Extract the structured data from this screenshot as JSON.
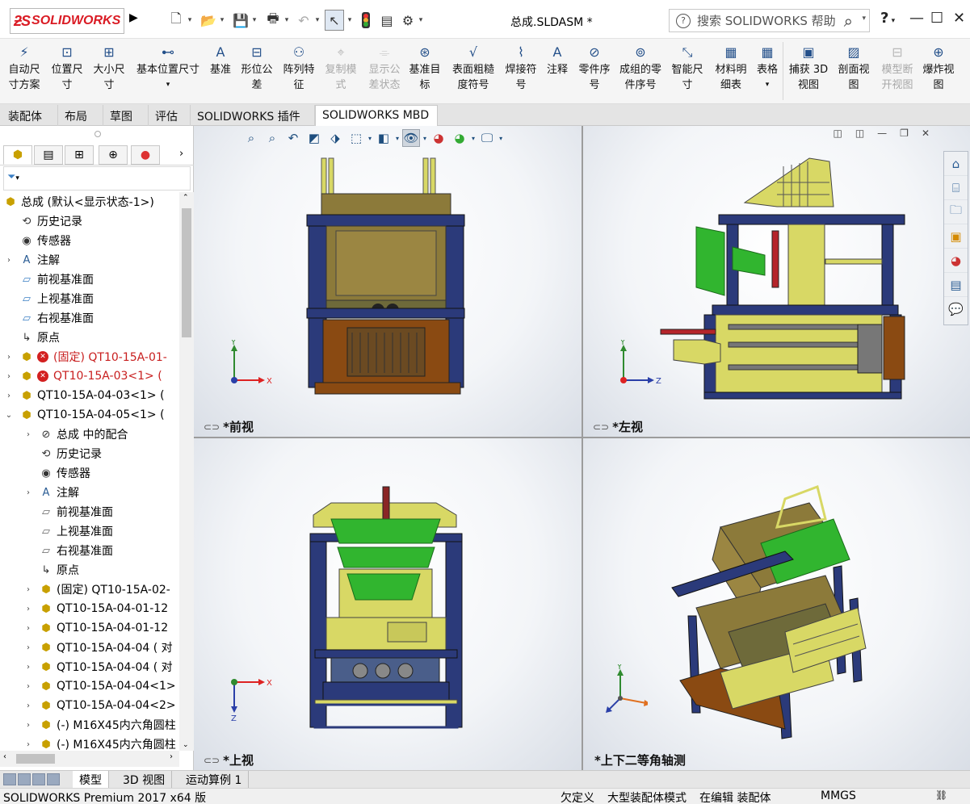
{
  "app": {
    "logo": "SOLIDWORKS",
    "doc_title": "总成.SLDASM *",
    "help_placeholder": "搜索 SOLIDWORKS 帮助",
    "help": "?",
    "colors": {
      "logo_red": "#da1b24",
      "steel_blue": "#2b3a7a",
      "yellow_green": "#d8d865",
      "green": "#31b52f",
      "brown": "#8a4a12"
    }
  },
  "commands": [
    {
      "label": "自动尺\n寸方案",
      "icon": "auto-dimension-icon"
    },
    {
      "label": "位置尺\n寸",
      "icon": "location-dimension-icon"
    },
    {
      "label": "大小尺\n寸",
      "icon": "size-dimension-icon"
    },
    {
      "label": "基本位置尺寸",
      "icon": "basic-location-dimension-icon"
    },
    {
      "label": "基准",
      "icon": "datum-icon"
    },
    {
      "label": "形位公\n差",
      "icon": "geometric-tolerance-icon"
    },
    {
      "label": "阵列特\n征",
      "icon": "pattern-feature-icon"
    },
    {
      "label": "复制模\n式",
      "icon": "copy-scheme-icon",
      "disabled": true
    },
    {
      "label": "显示公\n差状态",
      "icon": "show-tolerance-status-icon",
      "disabled": true
    },
    {
      "label": "基准目\n标",
      "icon": "datum-target-icon"
    },
    {
      "label": "表面粗糙\n度符号",
      "icon": "surface-finish-icon"
    },
    {
      "label": "焊接符\n号",
      "icon": "weld-symbol-icon"
    },
    {
      "label": "注释",
      "icon": "note-icon"
    },
    {
      "label": "零件序\n号",
      "icon": "balloon-icon"
    },
    {
      "label": "成组的零\n件序号",
      "icon": "stacked-balloon-icon"
    },
    {
      "label": "智能尺\n寸",
      "icon": "smart-dimension-icon"
    },
    {
      "label": "材料明\n细表",
      "icon": "bom-icon"
    },
    {
      "label": "表格",
      "icon": "table-icon"
    },
    {
      "label": "捕获 3D\n视图",
      "icon": "capture-3d-view-icon"
    },
    {
      "label": "剖面视\n图",
      "icon": "section-view-icon"
    },
    {
      "label": "模型断\n开视图",
      "icon": "model-break-view-icon",
      "disabled": true
    },
    {
      "label": "爆炸视\n图",
      "icon": "exploded-view-icon"
    }
  ],
  "tabs": [
    "装配体",
    "布局",
    "草图",
    "评估",
    "SOLIDWORKS 插件",
    "SOLIDWORKS MBD"
  ],
  "tree": [
    {
      "text": "总成  (默认<显示状态-1>)",
      "level": 0,
      "icon": "assembly",
      "exp": ""
    },
    {
      "text": "历史记录",
      "level": 1,
      "icon": "history"
    },
    {
      "text": "传感器",
      "level": 1,
      "icon": "sensor"
    },
    {
      "text": "注解",
      "level": 1,
      "icon": "annotation",
      "exp": "›"
    },
    {
      "text": "前视基准面",
      "level": 1,
      "icon": "plane"
    },
    {
      "text": "上视基准面",
      "level": 1,
      "icon": "plane"
    },
    {
      "text": "右视基准面",
      "level": 1,
      "icon": "plane"
    },
    {
      "text": "原点",
      "level": 1,
      "icon": "origin"
    },
    {
      "text": "(固定) QT10-15A-01-",
      "level": 1,
      "icon": "part",
      "exp": "›",
      "error": true
    },
    {
      "text": "QT10-15A-03<1> (",
      "level": 1,
      "icon": "part",
      "exp": "›",
      "error": true
    },
    {
      "text": "QT10-15A-04-03<1> (",
      "level": 1,
      "icon": "part",
      "exp": "›"
    },
    {
      "text": "QT10-15A-04-05<1> (",
      "level": 1,
      "icon": "part",
      "exp": "⌄"
    },
    {
      "text": "总成 中的配合",
      "level": 2,
      "icon": "mates",
      "exp": "›"
    },
    {
      "text": "历史记录",
      "level": 2,
      "icon": "history"
    },
    {
      "text": "传感器",
      "level": 2,
      "icon": "sensor"
    },
    {
      "text": "注解",
      "level": 2,
      "icon": "annotation",
      "exp": "›"
    },
    {
      "text": "前视基准面",
      "level": 2,
      "icon": "plane-outline"
    },
    {
      "text": "上视基准面",
      "level": 2,
      "icon": "plane-outline"
    },
    {
      "text": "右视基准面",
      "level": 2,
      "icon": "plane-outline"
    },
    {
      "text": "原点",
      "level": 2,
      "icon": "origin"
    },
    {
      "text": "(固定) QT10-15A-02-",
      "level": 2,
      "icon": "subasm",
      "exp": "›"
    },
    {
      "text": "QT10-15A-04-01-12",
      "level": 2,
      "icon": "subasm",
      "exp": "›"
    },
    {
      "text": "QT10-15A-04-01-12",
      "level": 2,
      "icon": "subasm",
      "exp": "›"
    },
    {
      "text": "QT10-15A-04-04 ( 对",
      "level": 2,
      "icon": "part",
      "exp": "›"
    },
    {
      "text": "QT10-15A-04-04 ( 对",
      "level": 2,
      "icon": "part",
      "exp": "›"
    },
    {
      "text": "QT10-15A-04-04<1>",
      "level": 2,
      "icon": "part",
      "exp": "›"
    },
    {
      "text": "QT10-15A-04-04<2>",
      "level": 2,
      "icon": "part",
      "exp": "›"
    },
    {
      "text": "(-) M16X45内六角圆柱",
      "level": 2,
      "icon": "part",
      "exp": "›"
    },
    {
      "text": "(-) M16X45内六角圆柱",
      "level": 2,
      "icon": "part",
      "exp": "›"
    }
  ],
  "viewports": [
    {
      "label": "*前视",
      "axes": [
        "X",
        "Y"
      ]
    },
    {
      "label": "*左视",
      "axes": [
        "Z",
        "Y"
      ]
    },
    {
      "label": "*上视",
      "axes": [
        "X",
        "Z"
      ]
    },
    {
      "label": "*上下二等角轴测",
      "axes": [
        "X",
        "Y",
        "Z"
      ]
    }
  ],
  "bottom_tabs": [
    "模型",
    "3D 视图",
    "运动算例 1"
  ],
  "status": {
    "product": "SOLIDWORKS Premium 2017 x64 版",
    "defined": "欠定义",
    "mode": "大型装配体模式",
    "editing": "在编辑 装配体",
    "units": "MMGS"
  }
}
